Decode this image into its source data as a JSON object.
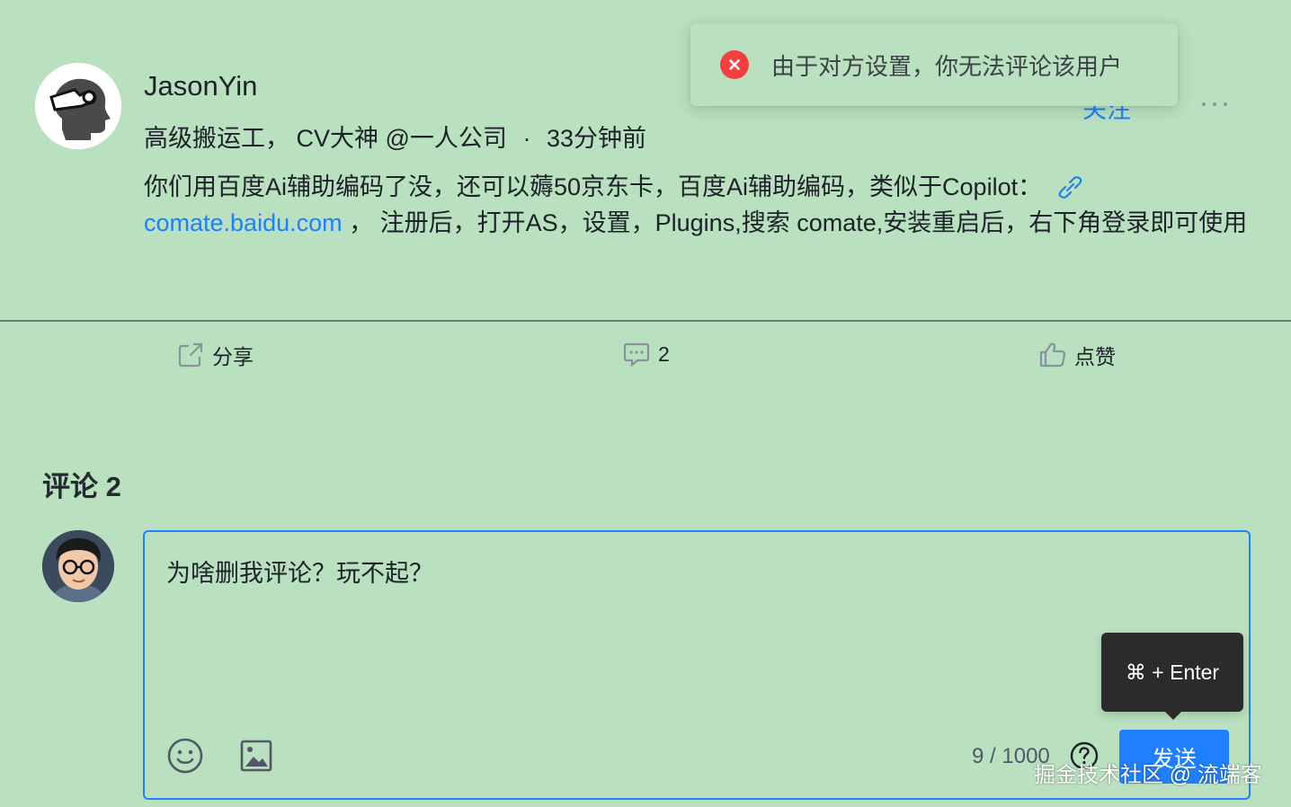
{
  "post": {
    "author_name": "JasonYin",
    "author_title": "高级搬运工， CV大神 @一人公司",
    "time_ago": "33分钟前",
    "meta_separator": "·",
    "follow_label": "关注",
    "content_line1": "你们用百度Ai辅助编码了没，还可以薅50京东卡，百度Ai辅助编码，类似于Copilot：",
    "content_link": "comate.baidu.com",
    "content_line2": " ， 注册后，打开AS，设置，Plugins,搜索 comate,安装重启后，右下角登录即可使用"
  },
  "actions": {
    "share_label": "分享",
    "comment_count": "2",
    "like_label": "点赞"
  },
  "comments": {
    "title": "评论 2",
    "input_value": "为啥删我评论？玩不起？",
    "char_count": "9",
    "char_limit": "1000",
    "counter_separator": " / ",
    "send_label": "发送",
    "shortcut_tooltip": "⌘ + Enter"
  },
  "toast": {
    "type": "error",
    "message": "由于对方设置，你无法评论该用户"
  },
  "watermark": "掘金技术社区 @ 流端客",
  "icons": {
    "more": "more-dots-icon",
    "link": "link-icon",
    "share": "share-icon",
    "comment": "comment-bubble-icon",
    "like": "thumbs-up-icon",
    "emoji": "emoji-icon",
    "image": "image-icon",
    "help": "question-circle-icon",
    "toast": "error-circle-icon"
  },
  "colors": {
    "background": "#b9e0bf",
    "accent": "#1e80ff",
    "error": "#f53f3f",
    "tooltip_bg": "#2b2b2b"
  }
}
